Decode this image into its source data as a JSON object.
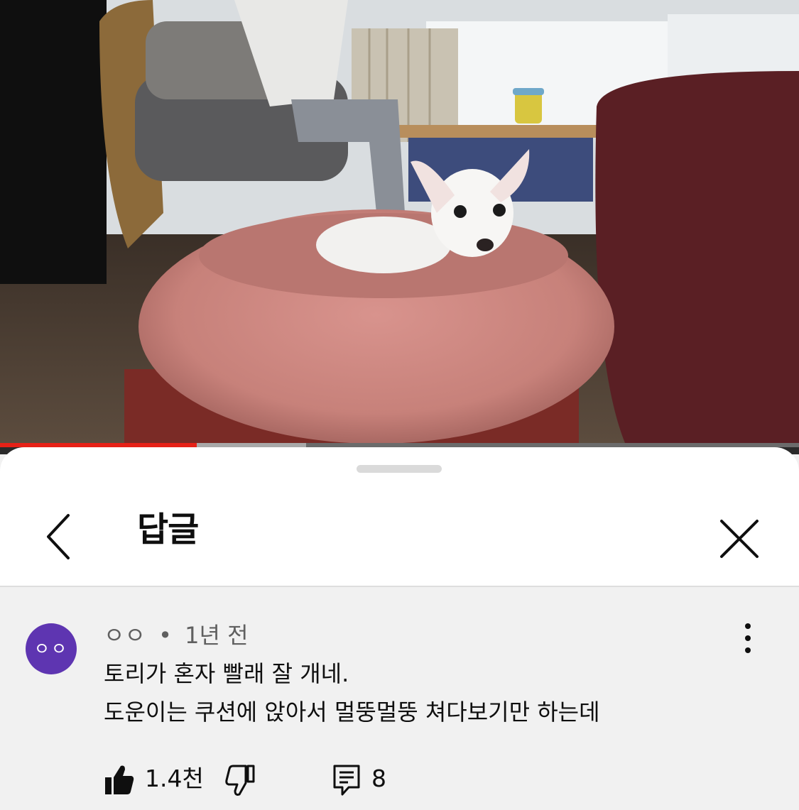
{
  "video": {
    "progress_played": 0.246,
    "progress_buffered": 0.383,
    "colors": {
      "played": "#e62117",
      "buffer": "#a8a8a8",
      "track": "#6b6b6b"
    }
  },
  "sheet": {
    "title": "답글",
    "back_icon": "chevron-left-icon",
    "close_icon": "close-icon"
  },
  "comment": {
    "avatar_text": "ㅇㅇ",
    "avatar_color": "#5e35b1",
    "author": "ㅇㅇ",
    "separator": "•",
    "time": "1년 전",
    "lines": [
      "토리가 혼자 빨래 잘 개네.",
      "도운이는 쿠션에 앉아서 멀뚱멀뚱 쳐다보기만 하는데"
    ],
    "likes": "1.4천",
    "replies": "8",
    "icons": [
      "thumbs-up-icon",
      "thumbs-down-icon",
      "reply-icon",
      "more-vertical-icon"
    ]
  }
}
